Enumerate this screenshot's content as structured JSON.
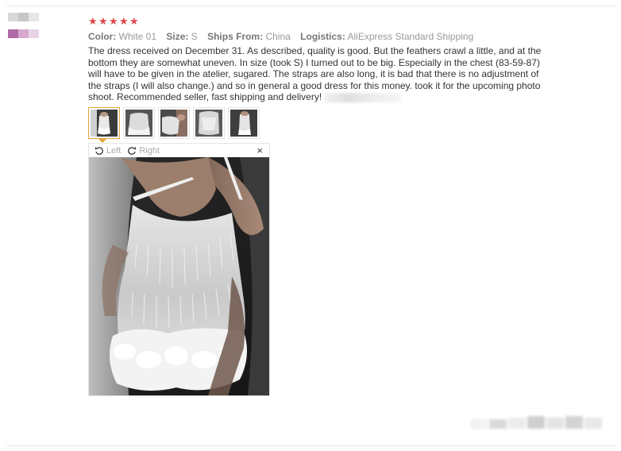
{
  "review": {
    "stars": 5,
    "attributes": [
      {
        "key": "Color:",
        "value": "White 01"
      },
      {
        "key": "Size:",
        "value": "S"
      },
      {
        "key": "Ships From:",
        "value": "China"
      },
      {
        "key": "Logistics:",
        "value": "AliExpress Standard Shipping"
      }
    ],
    "text": "The dress received on December 31. As described, quality is good. But the feathers crawl a little, and at the bottom they are somewhat uneven. In size (took S) I turned out to be big. Especially in the chest (83-59-87) will have to be given in the atelier, sugared. The straps are also long, it is bad that there is no adjustment of the straps (I will also change.) and so in general a good dress for this money. took it for the upcoming photo shoot. Recommended seller, fast shipping and delivery!"
  },
  "viewer": {
    "rotate_left": "Left",
    "rotate_right": "Right",
    "close": "×"
  },
  "colors": {
    "star": "#e0474c",
    "active_thumb": "#e6a23c",
    "key_text": "#777777",
    "value_text": "#999999"
  }
}
